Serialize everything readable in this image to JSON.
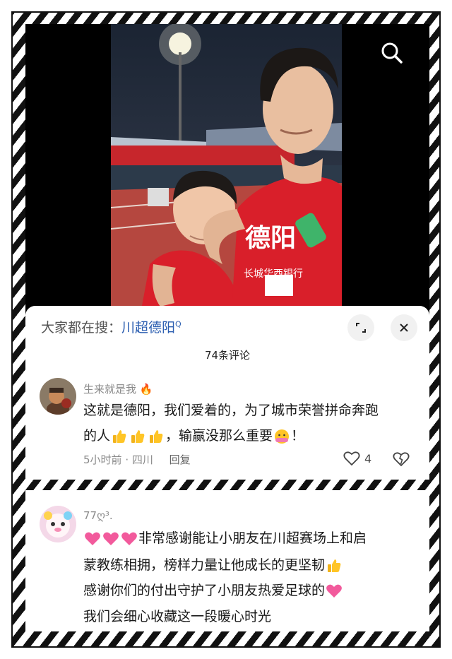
{
  "search_bar": {
    "prefix": "大家都在搜：",
    "keyword": "川超德阳",
    "keyword_suffix": "Q"
  },
  "comments_header": {
    "count_label": "74条评论"
  },
  "photo": {
    "jersey_text": "德阳",
    "sponsor_text": "长城华西银行"
  },
  "comments": [
    {
      "username": "生来就是我",
      "line1": "这就是德阳，我们爱着的，为了城市荣誉拼命奔跑",
      "line2_pre": "的人",
      "line2_mid": "，输赢没那么重要",
      "line2_end": "！",
      "time": "5小时前",
      "location": "四川",
      "reply_label": "回复",
      "likes": "4"
    },
    {
      "username": "77ღ³.",
      "line1": "非常感谢能让小朋友在川超赛场上和启",
      "line2": "蒙教练相拥，榜样力量让他成长的更坚韧",
      "line3": "感谢你们的付出守护了小朋友热爱足球的",
      "line4": "我们会细心收藏这一段暖心时光"
    }
  ],
  "colors": {
    "keyword": "#2a5db0",
    "jersey_red": "#d8202a"
  }
}
